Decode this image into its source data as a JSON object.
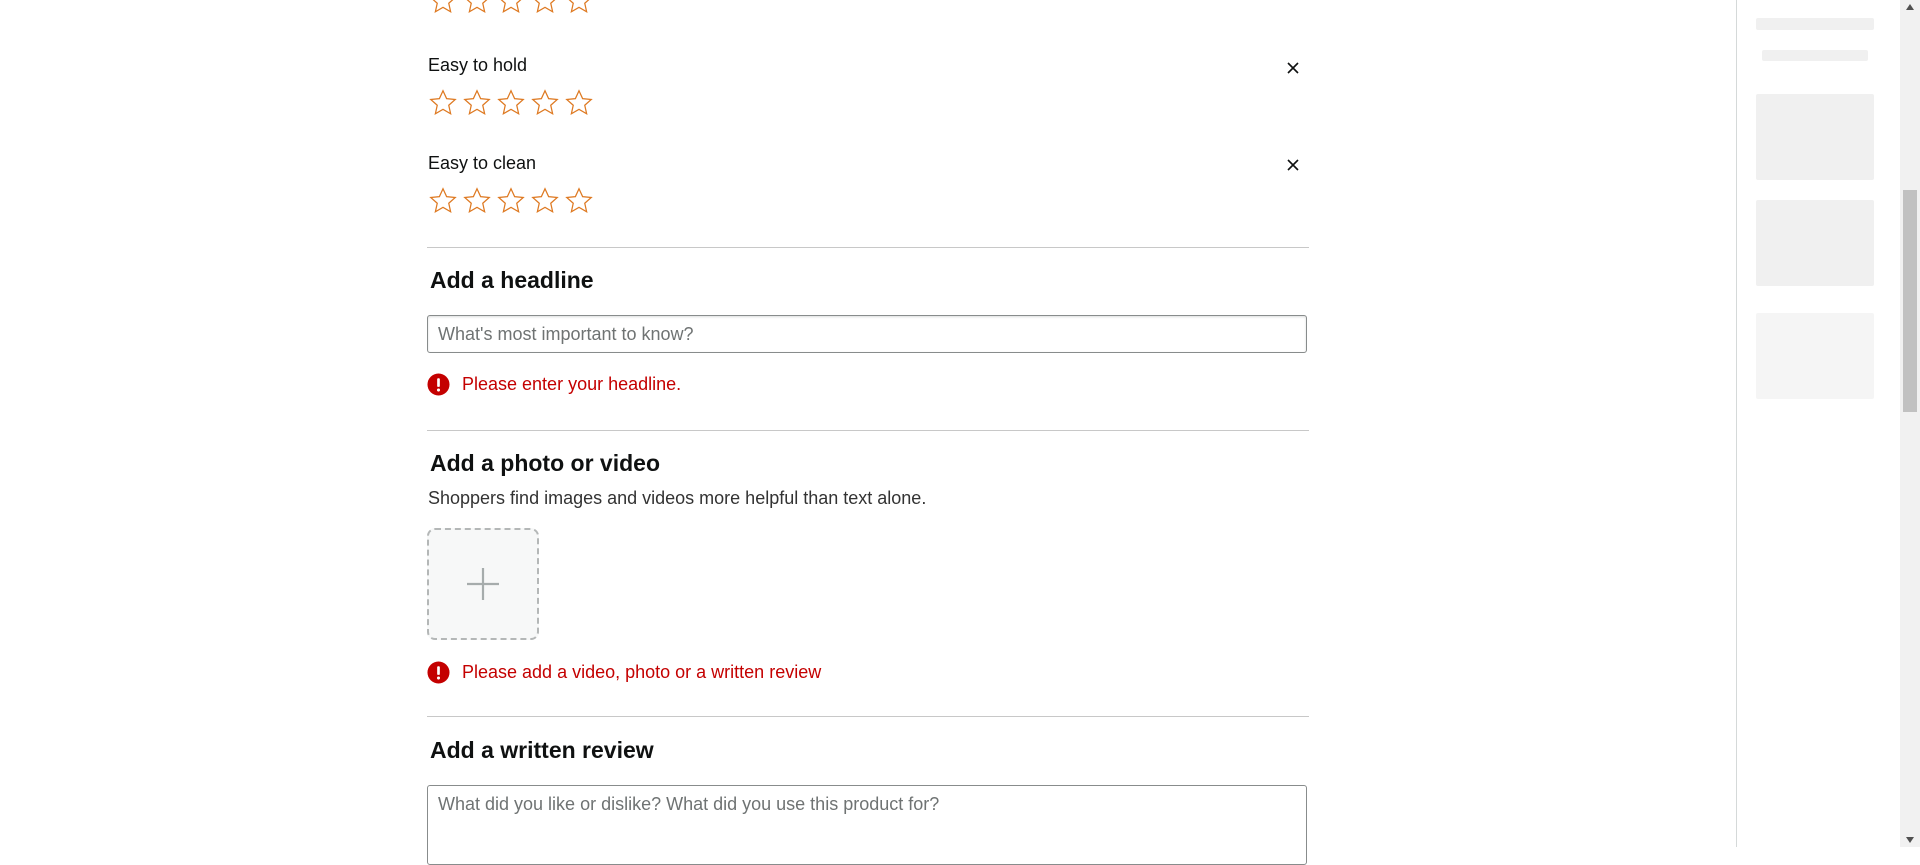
{
  "rating_attributes": [
    {
      "label": "",
      "stars": 5
    },
    {
      "label": "Easy to hold",
      "stars": 5
    },
    {
      "label": "Easy to clean",
      "stars": 5
    }
  ],
  "headline": {
    "title": "Add a headline",
    "placeholder": "What's most important to know?",
    "value": "",
    "error": "Please enter your headline."
  },
  "media": {
    "title": "Add a photo or video",
    "helper": "Shoppers find images and videos more helpful than text alone.",
    "error": "Please add a video, photo or a written review"
  },
  "written_review": {
    "title": "Add a written review",
    "placeholder": "What did you like or dislike? What did you use this product for?",
    "value": ""
  },
  "icons": {
    "star": "star-outline-icon",
    "close": "close-icon",
    "error": "error-exclamation-icon",
    "add": "plus-icon"
  },
  "colors": {
    "star_outline": "#de7921",
    "error": "#c40000",
    "error_icon_bg": "#c40000",
    "divider": "#c8c8c8",
    "skeleton": "#f0f0f0"
  }
}
